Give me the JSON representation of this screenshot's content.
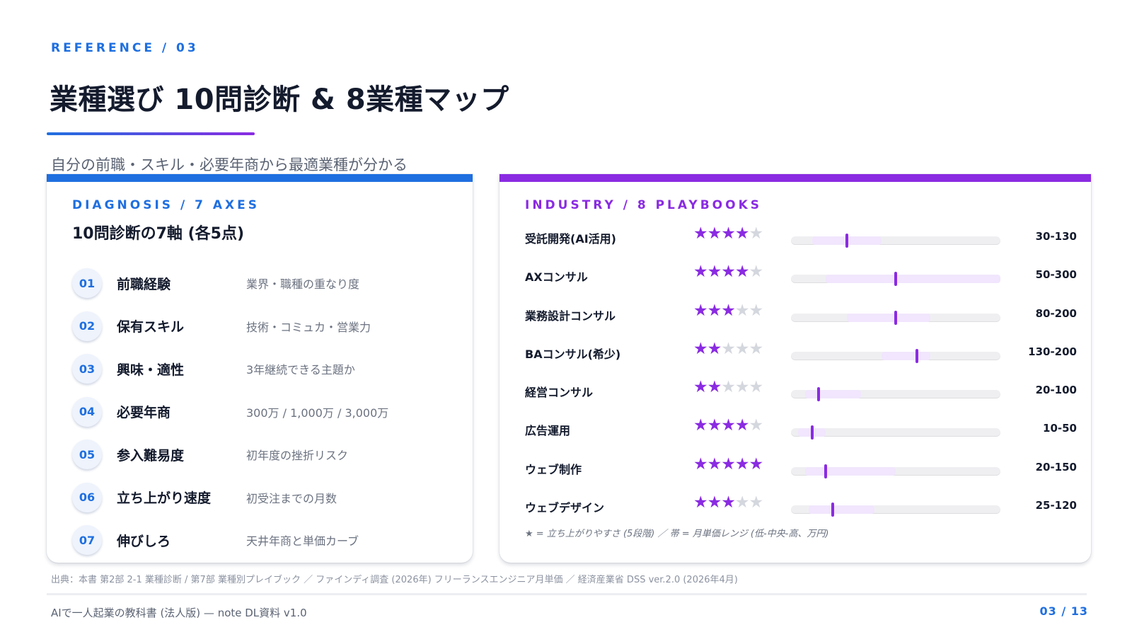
{
  "header": {
    "eyebrow": "REFERENCE  /  03",
    "title": "業種選び 10問診断 & 8業種マップ",
    "subtitle": "自分の前職・スキル・必要年商から最適業種が分かる"
  },
  "diagnosis": {
    "eyebrow": "DIAGNOSIS  /  7  AXES",
    "title": "10問診断の7軸 (各5点)",
    "axes": [
      {
        "num": "01",
        "label": "前職経験",
        "desc": "業界・職種の重なり度"
      },
      {
        "num": "02",
        "label": "保有スキル",
        "desc": "技術・コミュカ・営業力"
      },
      {
        "num": "03",
        "label": "興味・適性",
        "desc": "3年継続できる主題か"
      },
      {
        "num": "04",
        "label": "必要年商",
        "desc": "300万 / 1,000万 / 3,000万"
      },
      {
        "num": "05",
        "label": "参入難易度",
        "desc": "初年度の挫折リスク"
      },
      {
        "num": "06",
        "label": "立ち上がり速度",
        "desc": "初受注までの月数"
      },
      {
        "num": "07",
        "label": "伸びしろ",
        "desc": "天井年商と単価カーブ"
      }
    ]
  },
  "industry": {
    "eyebrow": "INDUSTRY  /  8  PLAYBOOKS",
    "legend": "★ = 立ち上がりやすさ (5段階)   ／   帯 = 月単価レンジ (低-中央-高、万円)",
    "colors": {
      "accent": "#8a2be2",
      "band": "#f1e6fd",
      "track": "#efeff2",
      "star_off": "#d4d7de"
    },
    "scale_max": 300,
    "rows": [
      {
        "name": "受託開発(AI活用)",
        "stars": 4,
        "range": "30-130",
        "low": 30,
        "mid": 80,
        "high": 130
      },
      {
        "name": "AXコンサル",
        "stars": 4,
        "range": "50-300",
        "low": 50,
        "mid": 150,
        "high": 300
      },
      {
        "name": "業務設計コンサル",
        "stars": 3,
        "range": "80-200",
        "low": 80,
        "mid": 150,
        "high": 200
      },
      {
        "name": "BAコンサル(希少)",
        "stars": 2,
        "range": "130-200",
        "low": 130,
        "mid": 180,
        "high": 200
      },
      {
        "name": "経営コンサル",
        "stars": 2,
        "range": "20-100",
        "low": 20,
        "mid": 40,
        "high": 100
      },
      {
        "name": "広告運用",
        "stars": 4,
        "range": "10-50",
        "low": 10,
        "mid": 30,
        "high": 50
      },
      {
        "name": "ウェブ制作",
        "stars": 5,
        "range": "20-150",
        "low": 20,
        "mid": 50,
        "high": 150
      },
      {
        "name": "ウェブデザイン",
        "stars": 3,
        "range": "25-120",
        "low": 25,
        "mid": 60,
        "high": 120
      }
    ]
  },
  "source": "出典：本書 第2部 2-1 業種診断 / 第7部 業種別プレイブック ／ ファインディ調査 (2026年) フリーランスエンジニア月単価 ／ 経済産業省 DSS ver.2.0 (2026年4月)",
  "footer": {
    "left": "AIで一人起業の教科書 (法人版) — note DL資料 v1.0",
    "right": "03 / 13"
  }
}
